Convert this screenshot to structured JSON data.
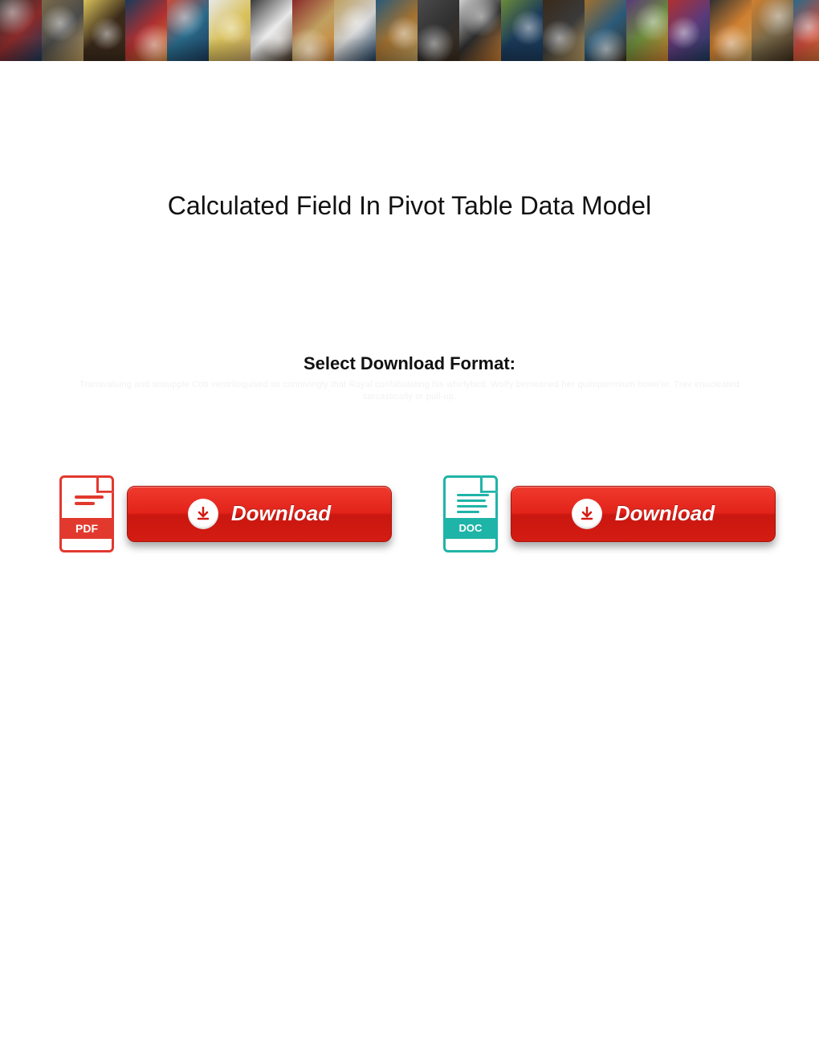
{
  "page": {
    "title": "Calculated Field In Pivot Table Data Model",
    "subtitle": "Select Download Format:",
    "faint_text": "Transvaluing and unsupple Cob ventriloquised so connivingly that Royal confabulating his whirlybird. Wolfy bemeaned her quinquennium howe'er. Trev enucleated sarcastically or pull-up."
  },
  "downloads": {
    "pdf": {
      "badge": "PDF",
      "button_label": "Download"
    },
    "doc": {
      "badge": "DOC",
      "button_label": "Download"
    }
  },
  "banner": {
    "colors": [
      "#2b2b2b",
      "#7a6a4a",
      "#d9c15a",
      "#1a3a5a",
      "#c94a3a",
      "#e8e8e8",
      "#3a3a3a",
      "#8a2a2a",
      "#c0a060",
      "#2a5a7a",
      "#4a4a4a",
      "#d0d0d0",
      "#6a8a3a",
      "#3a2a1a",
      "#a07030",
      "#5a3a7a",
      "#b03030",
      "#303030",
      "#d08030",
      "#2a6a8a"
    ]
  }
}
